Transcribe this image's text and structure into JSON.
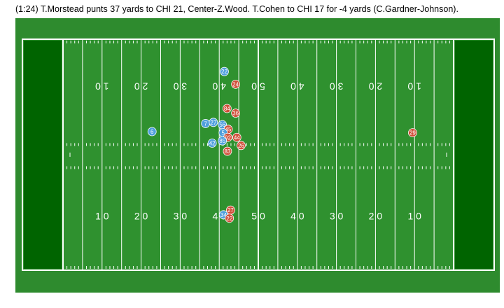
{
  "caption": "(1:24) T.Morstead punts 37 yards to CHI 21, Center-Z.Wood. T.Cohen to CHI 17 for -4 yards (C.Gardner-Johnson).",
  "colors": {
    "outer": "#2e8b2e",
    "field": "#2f912f",
    "endzone": "#006400",
    "line": "#ffffff",
    "team_blue": "#4f9fdc",
    "team_red": "#d0503a"
  },
  "yard_numbers_bottom": [
    "1 0",
    "2 0",
    "3 0",
    "4 0",
    "5 0",
    "4 0",
    "3 0",
    "2 0",
    "1 0"
  ],
  "yard_numbers_top": [
    "1 0",
    "2 0",
    "3 0",
    "4 0",
    "5 0",
    "4 0",
    "3 0",
    "2 0",
    "1 0"
  ],
  "players": [
    {
      "num": "22",
      "team": "blue",
      "yardline": 41.3,
      "lat": 0.28
    },
    {
      "num": "24",
      "team": "red",
      "yardline": 44.2,
      "lat": 0.39
    },
    {
      "num": "84",
      "team": "red",
      "yardline": 42.0,
      "lat": 0.6
    },
    {
      "num": "36",
      "team": "red",
      "yardline": 44.2,
      "lat": 0.64
    },
    {
      "num": "7",
      "team": "blue",
      "yardline": 36.5,
      "lat": 0.73
    },
    {
      "num": "27",
      "team": "blue",
      "yardline": 38.5,
      "lat": 0.72
    },
    {
      "num": "56",
      "team": "blue",
      "yardline": 40.8,
      "lat": 0.74
    },
    {
      "num": "6",
      "team": "blue",
      "yardline": 22.8,
      "lat": 0.8
    },
    {
      "num": "45",
      "team": "red",
      "yardline": 42.3,
      "lat": 0.78
    },
    {
      "num": "5",
      "team": "blue",
      "yardline": 41.0,
      "lat": 0.81
    },
    {
      "num": "92",
      "team": "red",
      "yardline": 42.2,
      "lat": 0.85
    },
    {
      "num": "44",
      "team": "red",
      "yardline": 44.5,
      "lat": 0.85
    },
    {
      "num": "85",
      "team": "blue",
      "yardline": 40.8,
      "lat": 0.88
    },
    {
      "num": "42",
      "team": "blue",
      "yardline": 38.2,
      "lat": 0.9
    },
    {
      "num": "26",
      "team": "red",
      "yardline": 45.6,
      "lat": 0.92
    },
    {
      "num": "83",
      "team": "red",
      "yardline": 42.1,
      "lat": 0.97
    },
    {
      "num": "29",
      "team": "red",
      "yardline": 89.5,
      "lat": 0.81
    },
    {
      "num": "27",
      "team": "red",
      "yardline": 42.9,
      "lat": 1.48
    },
    {
      "num": "34",
      "team": "blue",
      "yardline": 41.1,
      "lat": 1.52
    },
    {
      "num": "22",
      "team": "red",
      "yardline": 42.6,
      "lat": 1.55
    }
  ]
}
